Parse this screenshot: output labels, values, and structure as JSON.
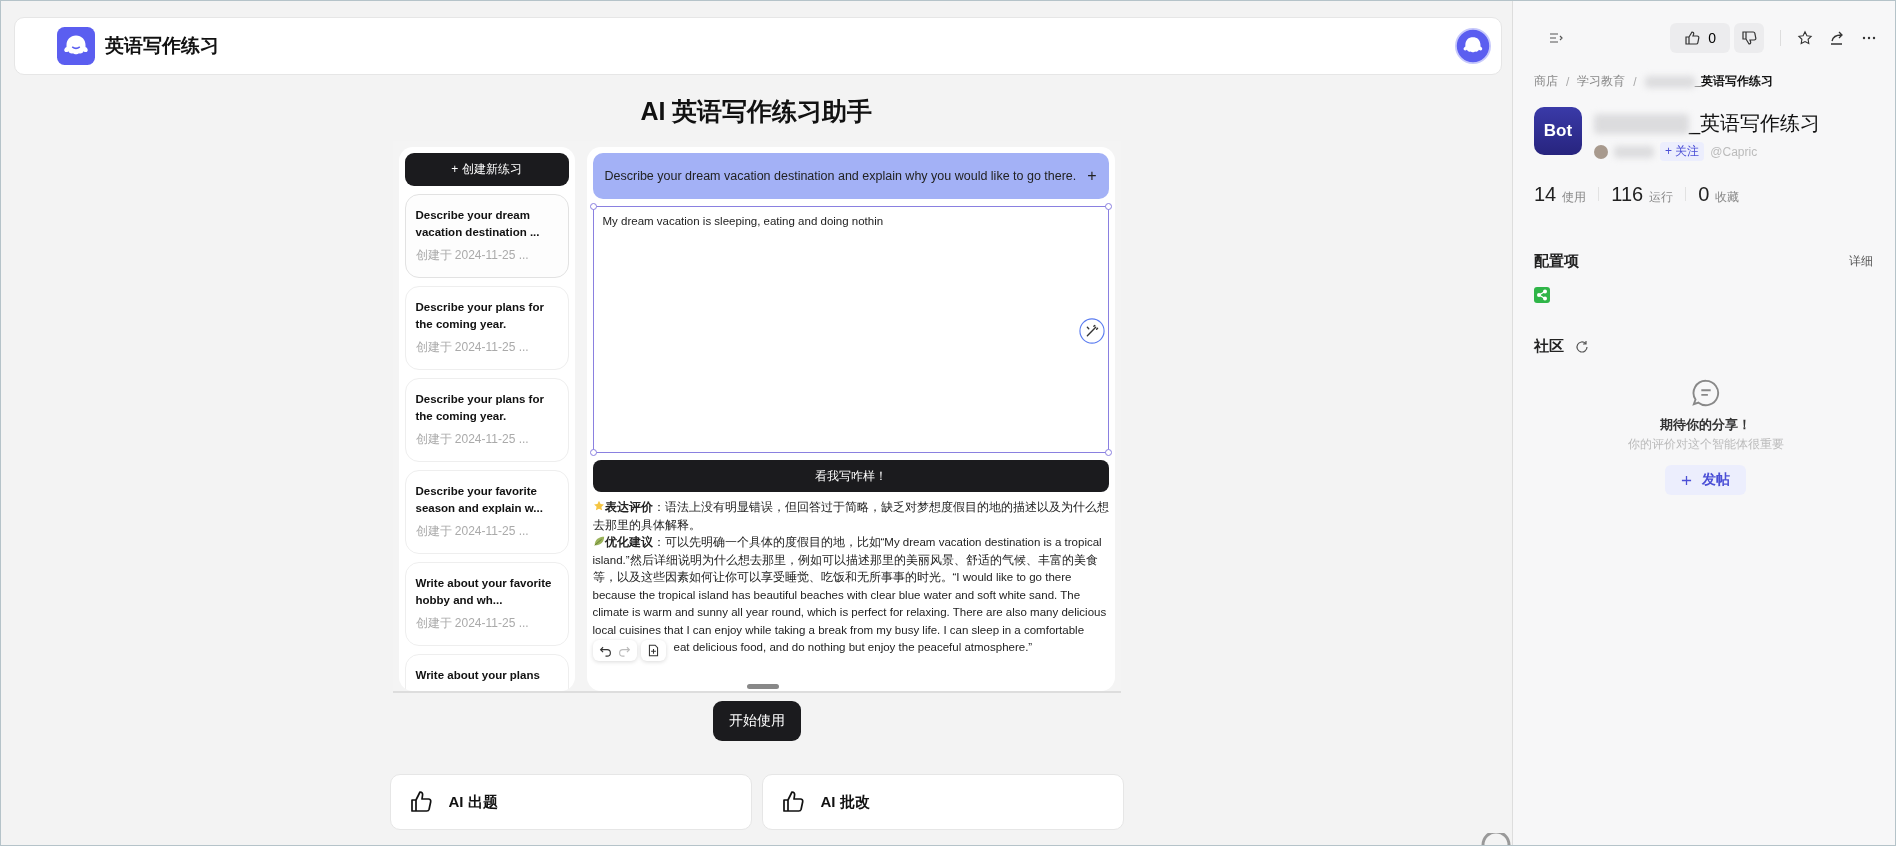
{
  "header": {
    "title": "英语写作练习"
  },
  "page_title": "AI 英语写作练习助手",
  "preview": {
    "create_button": "+ 创建新练习",
    "exercises": [
      {
        "title": "Describe your dream vacation destination ...",
        "date": "创建于 2024-11-25 ...",
        "selected": true
      },
      {
        "title": "Describe your plans for the coming year.",
        "date": "创建于 2024-11-25 ...",
        "selected": false
      },
      {
        "title": "Describe your plans for the coming year.",
        "date": "创建于 2024-11-25 ...",
        "selected": false
      },
      {
        "title": "Describe your favorite season and explain w...",
        "date": "创建于 2024-11-25 ...",
        "selected": false
      },
      {
        "title": "Write about your favorite hobby and wh...",
        "date": "创建于 2024-11-25 ...",
        "selected": false
      },
      {
        "title": "Write about your plans"
      }
    ],
    "prompt": "Describe your dream vacation destination and explain why you would like to go there.",
    "prompt_add": "+",
    "answer": "My dream vacation is sleeping, eating and doing nothin",
    "check_button": "看我写咋样！",
    "feedback": [
      {
        "kind": "star",
        "text": "**表达评价**：语法上没有明显错误，但回答过于简略，缺乏对梦想度假目的地的描述以及为什么想去那里的具体解释。"
      },
      {
        "kind": "leaf",
        "text": "**优化建议**：可以先明确一个具体的度假目的地，比如“My dream vacation destination is a tropical island.”然后详细说明为什么想去那里，例如可以描述那里的美丽风景、舒适的气候、丰富的美食等，以及这些因素如何让你可以享受睡觉、吃饭和无所事事的时光。“I would like to go there because the tropical island has beautiful beaches with clear blue water and soft white sand. The climate is warm and sunny all year round, which is perfect for relaxing. There are also many delicious local cuisines that I can enjoy while taking a break from my busy life. I can sleep in a comfortable",
        "text_after": "eat delicious food, and do nothing but enjoy the peaceful atmosphere.”"
      }
    ]
  },
  "start_button": "开始使用",
  "features": [
    {
      "label": "AI 出题"
    },
    {
      "label": "AI 批改"
    }
  ],
  "sidebar": {
    "like_count": "0",
    "breadcrumb": [
      {
        "text": "商店"
      },
      {
        "separator": "/",
        "text": "学习教育"
      },
      {
        "separator": "/",
        "text": "_英语写作练习"
      }
    ],
    "bot_logo": "Bot",
    "bot_name": "_英语写作练习",
    "follow": "+ 关注",
    "handle": "@Capric",
    "stats": [
      {
        "value": "14",
        "label": "使用"
      },
      {
        "value": "116",
        "label": "运行"
      },
      {
        "value": "0",
        "label": "收藏"
      }
    ],
    "config_title": "配置项",
    "config_detail": "详细",
    "community_title": "社区",
    "empty_title": "期待你的分享！",
    "empty_text": "你的评价对这个智能体很重要",
    "post_button": "发帖"
  }
}
